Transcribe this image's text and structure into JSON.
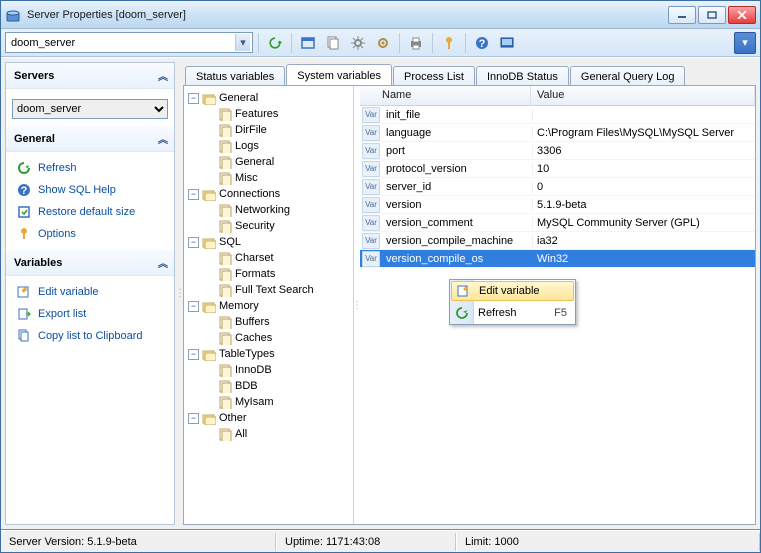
{
  "window": {
    "title": "Server Properties [doom_server]"
  },
  "toolbar": {
    "server_combo_value": "doom_server"
  },
  "side": {
    "servers": {
      "title": "Servers",
      "combo_selected": "doom_server"
    },
    "general": {
      "title": "General",
      "refresh": "Refresh",
      "help": "Show SQL Help",
      "restore": "Restore default size",
      "options": "Options"
    },
    "variables": {
      "title": "Variables",
      "edit": "Edit variable",
      "export": "Export list",
      "copy": "Copy list to Clipboard"
    }
  },
  "tabs": {
    "status": "Status variables",
    "system": "System variables",
    "process": "Process List",
    "innodb": "InnoDB Status",
    "querylog": "General Query Log"
  },
  "tree": [
    {
      "expanded": true,
      "label": "General",
      "children": [
        "Features",
        "DirFile",
        "Logs",
        "General",
        "Misc"
      ]
    },
    {
      "expanded": true,
      "label": "Connections",
      "children": [
        "Networking",
        "Security"
      ]
    },
    {
      "expanded": true,
      "label": "SQL",
      "children": [
        "Charset",
        "Formats",
        "Full Text Search"
      ]
    },
    {
      "expanded": true,
      "label": "Memory",
      "children": [
        "Buffers",
        "Caches"
      ]
    },
    {
      "expanded": true,
      "label": "TableTypes",
      "children": [
        "InnoDB",
        "BDB",
        "MyIsam"
      ]
    },
    {
      "expanded": true,
      "label": "Other",
      "children": [
        "All"
      ]
    }
  ],
  "table": {
    "col_name": "Name",
    "col_value": "Value",
    "rows": [
      {
        "name": "init_file",
        "value": ""
      },
      {
        "name": "language",
        "value": "C:\\Program Files\\MySQL\\MySQL Server"
      },
      {
        "name": "port",
        "value": "3306"
      },
      {
        "name": "protocol_version",
        "value": "10"
      },
      {
        "name": "server_id",
        "value": "0"
      },
      {
        "name": "version",
        "value": "5.1.9-beta"
      },
      {
        "name": "version_comment",
        "value": "MySQL Community Server (GPL)"
      },
      {
        "name": "version_compile_machine",
        "value": "ia32"
      },
      {
        "name": "version_compile_os",
        "value": "Win32",
        "selected": true
      }
    ]
  },
  "context_menu": {
    "edit": "Edit variable",
    "refresh": "Refresh",
    "refresh_key": "F5"
  },
  "statusbar": {
    "version": "Server Version: 5.1.9-beta",
    "uptime": "Uptime: 1171:43:08",
    "limit": "Limit: 1000"
  }
}
